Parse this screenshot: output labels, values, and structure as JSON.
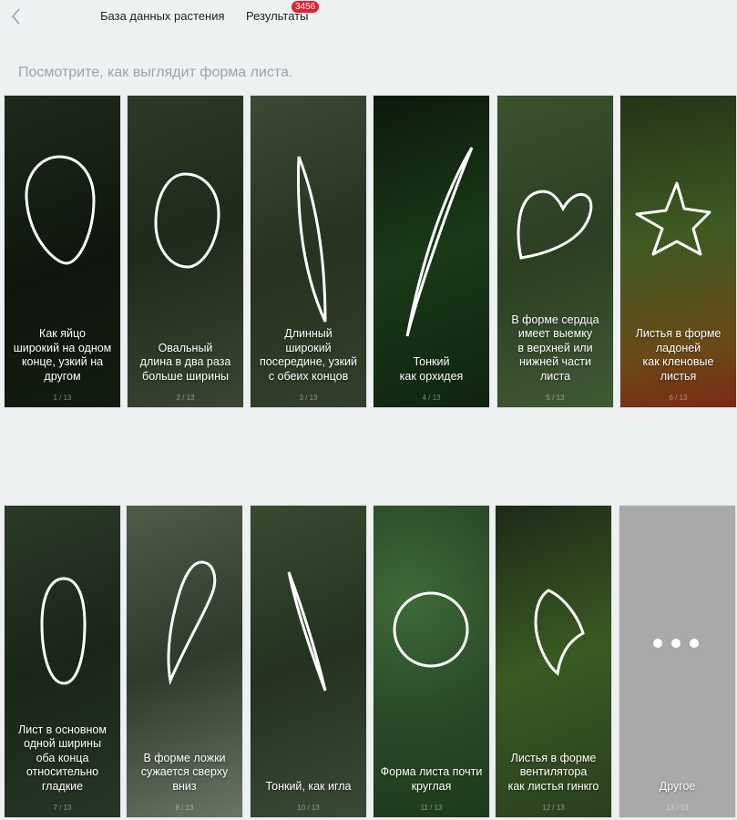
{
  "header": {
    "tabs": [
      {
        "label": "База данных растения"
      },
      {
        "label": "Результаты",
        "badge": "3456"
      }
    ]
  },
  "heading": "Посмотрите, как выглядит форма листа.",
  "cards": [
    {
      "caption": "Как яйцо\nширокий на одном\nконце, узкий на\nдругом",
      "counter": "1 / 13"
    },
    {
      "caption": "Овальный\nдлина в два раза\nбольше ширины",
      "counter": "2 / 13"
    },
    {
      "caption": "Длинный\nширокий\nпосередине, узкий\nс обеих концов",
      "counter": "3 / 13"
    },
    {
      "caption": "Тонкий\nкак орхидея",
      "counter": "4 / 13"
    },
    {
      "caption": "В форме сердца\nимеет выемку\nв верхней или\nнижней части\nлиста",
      "counter": "5 / 13"
    },
    {
      "caption": "Листья в форме\nладоней\nкак кленовые\nлистья",
      "counter": "6 / 13"
    },
    {
      "caption": "Лист в основном\nодной ширины\nоба конца\nотносительно\nгладкие",
      "counter": "7 / 13"
    },
    {
      "caption": "В форме ложки\nсужается сверху\nвниз",
      "counter": "8 / 13"
    },
    {
      "caption": "Тонкий, как игла",
      "counter": "10 / 13"
    },
    {
      "caption": "Форма листа почти\nкруглая",
      "counter": "11 / 13"
    },
    {
      "caption": "Листья в форме\nвентилятора\nкак листья гинкго",
      "counter": "12 / 13"
    },
    {
      "caption": "Другое",
      "counter": "13 / 13"
    }
  ]
}
